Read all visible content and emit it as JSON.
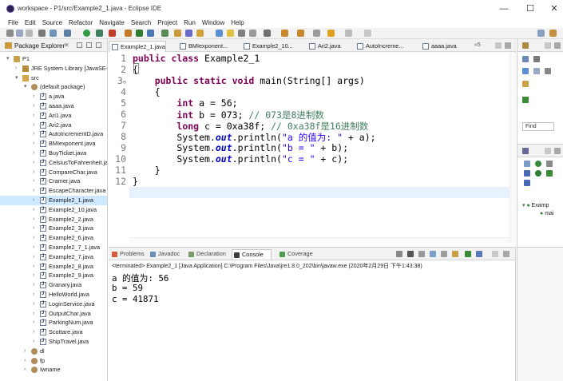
{
  "window": {
    "title": "workspace - P1/src/Example2_1.java - Eclipse IDE",
    "controls": [
      "—",
      "☐",
      "✕"
    ]
  },
  "menu": [
    "File",
    "Edit",
    "Source",
    "Refactor",
    "Navigate",
    "Search",
    "Project",
    "Run",
    "Window",
    "Help"
  ],
  "package_explorer": {
    "title": "Package Explorer",
    "rows": [
      {
        "label": "P1",
        "depth": 0,
        "arrow": "▾",
        "icon": "project-icon"
      },
      {
        "label": "JRE System Library [JavaSE-1.8]",
        "depth": 1,
        "arrow": "›",
        "icon": "library-icon"
      },
      {
        "label": "src",
        "depth": 1,
        "arrow": "▾",
        "icon": "source-folder-icon"
      },
      {
        "label": "(default package)",
        "depth": 2,
        "arrow": "▾",
        "icon": "package-icon"
      },
      {
        "label": "a.java",
        "depth": 3,
        "arrow": "›",
        "icon": "java-file-icon"
      },
      {
        "label": "aaaa.java",
        "depth": 3,
        "arrow": "›",
        "icon": "java-file-icon"
      },
      {
        "label": "Ari1.java",
        "depth": 3,
        "arrow": "›",
        "icon": "java-file-icon"
      },
      {
        "label": "Ari2.java",
        "depth": 3,
        "arrow": "›",
        "icon": "java-file-icon"
      },
      {
        "label": "AutoIncrementD.java",
        "depth": 3,
        "arrow": "›",
        "icon": "java-file-icon"
      },
      {
        "label": "BMIexponent.java",
        "depth": 3,
        "arrow": "›",
        "icon": "java-file-icon"
      },
      {
        "label": "BuyTicket.java",
        "depth": 3,
        "arrow": "›",
        "icon": "java-file-icon"
      },
      {
        "label": "CelsiusToFahrenheit.java",
        "depth": 3,
        "arrow": "›",
        "icon": "java-file-icon"
      },
      {
        "label": "CompareChar.java",
        "depth": 3,
        "arrow": "›",
        "icon": "java-file-icon"
      },
      {
        "label": "Cramer.java",
        "depth": 3,
        "arrow": "›",
        "icon": "java-file-icon"
      },
      {
        "label": "EscapeCharacter.java",
        "depth": 3,
        "arrow": "›",
        "icon": "java-file-icon"
      },
      {
        "label": "Example2_1.java",
        "depth": 3,
        "arrow": "›",
        "icon": "java-file-icon",
        "selected": true
      },
      {
        "label": "Example2_10.java",
        "depth": 3,
        "arrow": "›",
        "icon": "java-file-icon"
      },
      {
        "label": "Example2_2.java",
        "depth": 3,
        "arrow": "›",
        "icon": "java-file-icon"
      },
      {
        "label": "Example2_3.java",
        "depth": 3,
        "arrow": "›",
        "icon": "java-file-icon"
      },
      {
        "label": "Example2_6.java",
        "depth": 3,
        "arrow": "›",
        "icon": "java-file-icon"
      },
      {
        "label": "Example2_7_1.java",
        "depth": 3,
        "arrow": "›",
        "icon": "java-file-icon"
      },
      {
        "label": "Example2_7.java",
        "depth": 3,
        "arrow": "›",
        "icon": "java-file-icon"
      },
      {
        "label": "Example2_8.java",
        "depth": 3,
        "arrow": "›",
        "icon": "java-file-icon"
      },
      {
        "label": "Example2_9.java",
        "depth": 3,
        "arrow": "›",
        "icon": "java-file-icon"
      },
      {
        "label": "Granary.java",
        "depth": 3,
        "arrow": "›",
        "icon": "java-file-icon"
      },
      {
        "label": "HelloWorld.java",
        "depth": 3,
        "arrow": "›",
        "icon": "java-file-icon"
      },
      {
        "label": "LoginService.java",
        "depth": 3,
        "arrow": "›",
        "icon": "java-file-icon"
      },
      {
        "label": "OutputChar.java",
        "depth": 3,
        "arrow": "›",
        "icon": "java-file-icon"
      },
      {
        "label": "ParkingNum.java",
        "depth": 3,
        "arrow": "›",
        "icon": "java-file-icon"
      },
      {
        "label": "Scottare.java",
        "depth": 3,
        "arrow": "›",
        "icon": "java-file-icon"
      },
      {
        "label": "ShipTravel.java",
        "depth": 3,
        "arrow": "›",
        "icon": "java-file-icon"
      },
      {
        "label": "dl",
        "depth": 2,
        "arrow": "›",
        "icon": "package-icon"
      },
      {
        "label": "fp",
        "depth": 2,
        "arrow": "›",
        "icon": "package-icon"
      },
      {
        "label": "Iwname",
        "depth": 2,
        "arrow": "›",
        "icon": "package-icon"
      }
    ]
  },
  "editor": {
    "tabs": [
      "Example2_1.java",
      "BMIexponent...",
      "Example2_10...",
      "Ari2.java",
      "AutoIncreme...",
      "aaaa.java"
    ],
    "tabs_overflow": "»5",
    "line_numbers": [
      "1",
      "2",
      "3",
      "4",
      "5",
      "6",
      "7",
      "8",
      "9",
      "10",
      "11",
      "12"
    ],
    "line3_marker": "⊖",
    "code": {
      "l1": [
        "public class",
        " Example2_1"
      ],
      "l2": "{",
      "l3": [
        "    ",
        "public static void",
        " main(String[] args)"
      ],
      "l4": "    {",
      "l5": [
        "        ",
        "int",
        " a = 56;"
      ],
      "l6": [
        "        ",
        "int",
        " b = 073; ",
        "// 073是8进制数"
      ],
      "l7": [
        "        ",
        "long",
        " c = 0xa38f; ",
        "// 0xa38f是16进制数"
      ],
      "l8": [
        "        System.",
        "out",
        ".println(",
        "\"a 的值为: \"",
        " + a);"
      ],
      "l9": [
        "        System.",
        "out",
        ".println(",
        "\"b = \"",
        " + b);"
      ],
      "l10": [
        "        System.",
        "out",
        ".println(",
        "\"c = \"",
        " + c);"
      ],
      "l11": "    }",
      "l12": "}"
    }
  },
  "console": {
    "tabs": [
      "Problems",
      "Javadoc",
      "Declaration",
      "Console",
      "Coverage"
    ],
    "status": "<terminated> Example2_1 [Java Application] C:\\Program Files\\Java\\jre1.8.0_202\\bin\\javaw.exe (2020年2月29日 下午1:43:38)",
    "output": [
      "a 的值为: 56",
      "b = 59",
      "c = 41871"
    ]
  },
  "right_panels": {
    "find_placeholder": "Find",
    "outline_item": "Examp",
    "outline_sub": "mai"
  },
  "colors": {
    "keyword": "#7f0055",
    "comment": "#3f7f5f",
    "string": "#2a00ff",
    "field": "#0000c0",
    "selection": "#cde8ff",
    "current_line": "#e8f2fe"
  }
}
